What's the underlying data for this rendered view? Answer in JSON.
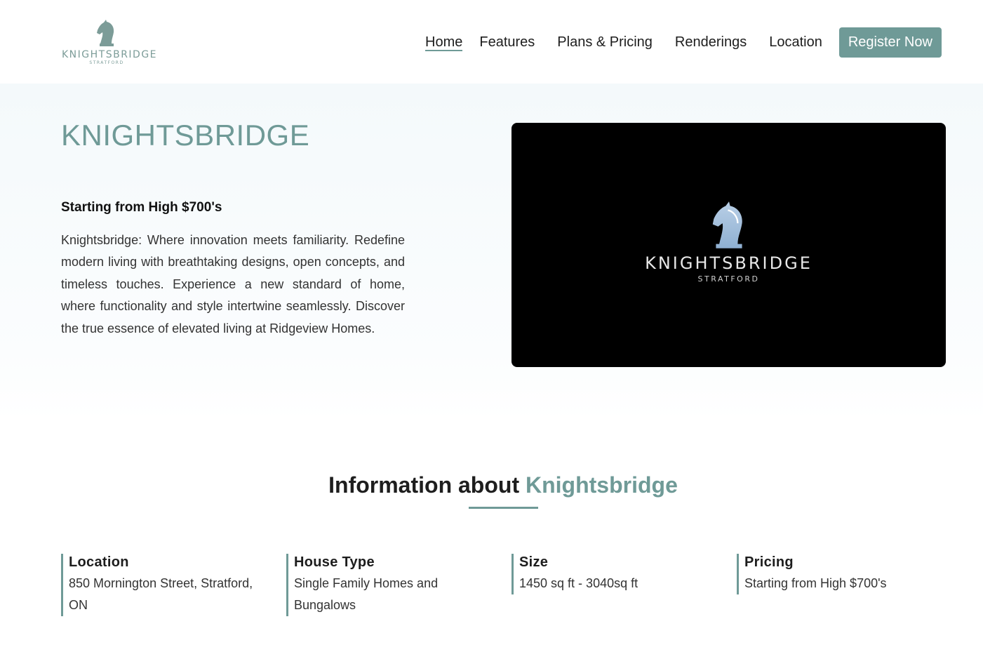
{
  "header": {
    "logo": {
      "wordmark": "KNIGHTSBRIDGE",
      "sub": "STRATFORD",
      "icon": "knight-chess-icon"
    },
    "nav": [
      {
        "label": "Home",
        "active": true
      },
      {
        "label": "Features"
      },
      {
        "label": "Plans & Pricing"
      },
      {
        "label": "Renderings"
      },
      {
        "label": "Location"
      }
    ],
    "cta_label": "Register Now"
  },
  "hero": {
    "title": "KNIGHTSBRIDGE",
    "subtitle": "Starting from High $700's",
    "description": "Knightsbridge: Where innovation meets familiarity. Redefine modern living with breathtaking designs, open concepts, and timeless touches. Experience a new standard of home, where functionality and style intertwine seamlessly. Discover the true essence of elevated living at Ridgeview Homes.",
    "video": {
      "wordmark": "KNIGHTSBRIDGE",
      "sub": "STRATFORD",
      "icon": "knight-chess-icon"
    }
  },
  "info": {
    "title_prefix": "Information about",
    "title_accent": "Knightsbridge",
    "items": [
      {
        "label": "Location",
        "value": "850 Mornington Street, Stratford, ON"
      },
      {
        "label": "House Type",
        "value": "Single Family Homes and Bungalows"
      },
      {
        "label": "Size",
        "value": "1450 sq ft - 3040sq ft"
      },
      {
        "label": "Pricing",
        "value": "Starting from High $700's"
      }
    ]
  },
  "colors": {
    "accent": "#6f9a97",
    "video_bg": "#000000",
    "hero_bg": "#f4f9fb"
  }
}
